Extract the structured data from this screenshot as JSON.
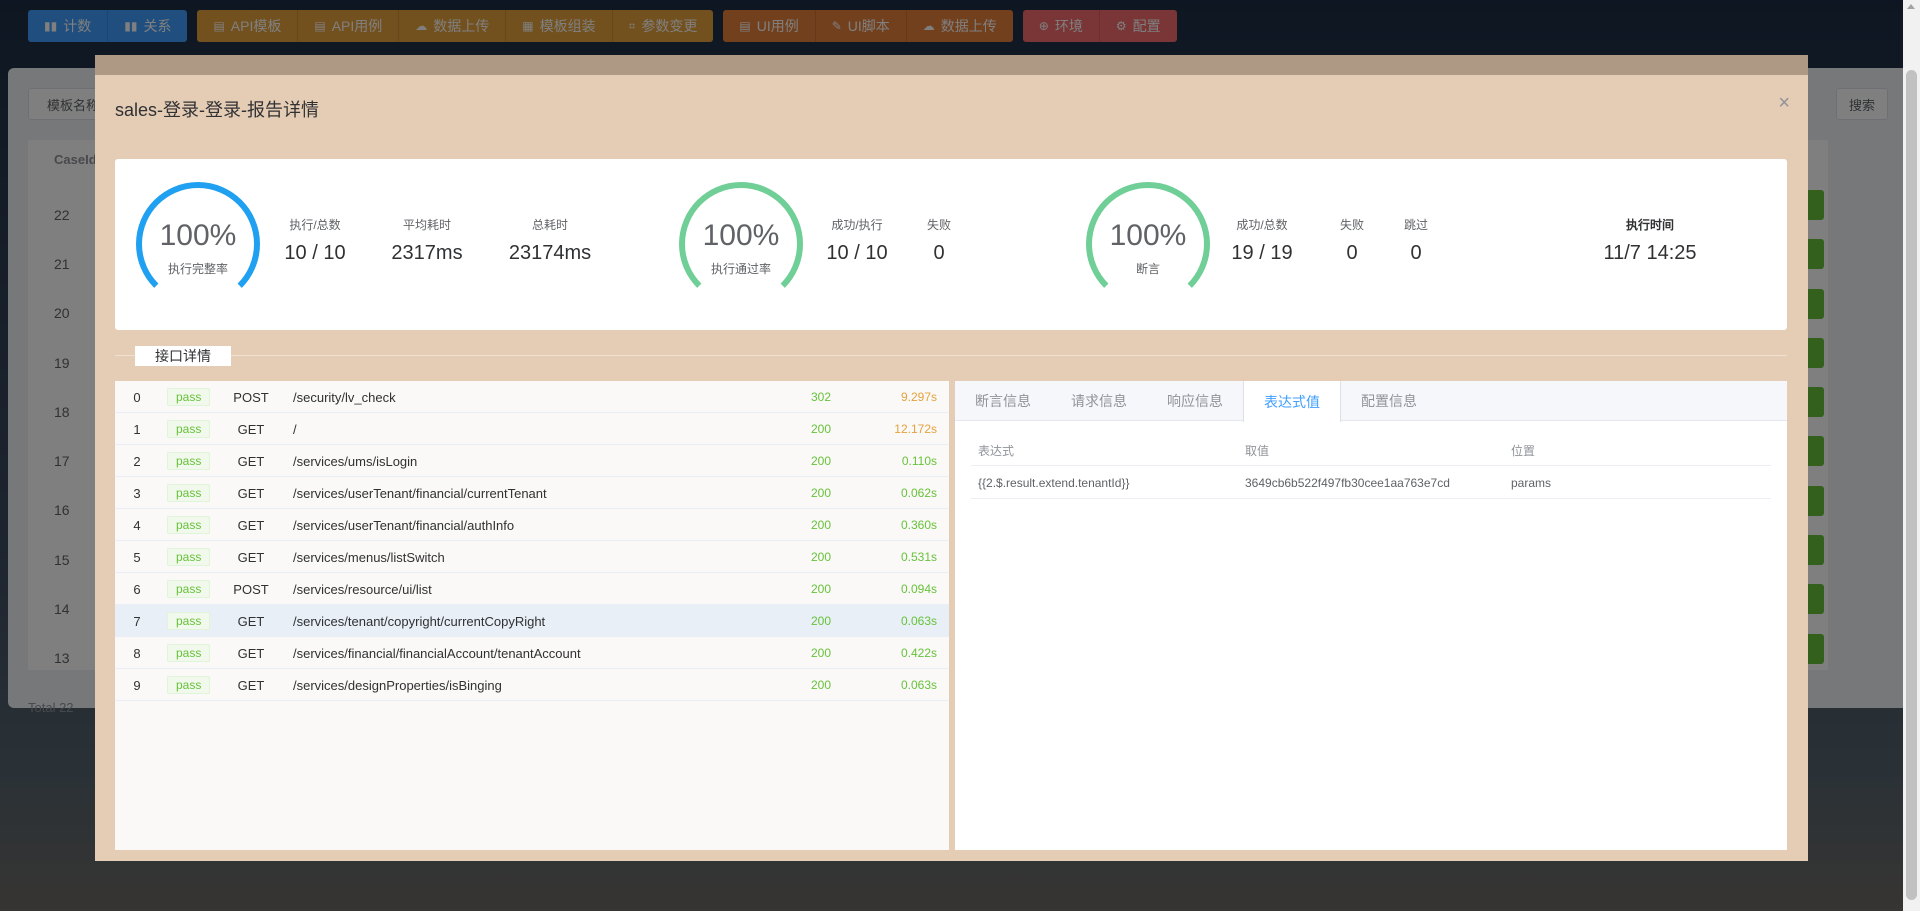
{
  "topnav": {
    "group1": [
      {
        "icon": "bar-chart-icon",
        "label": "计数"
      },
      {
        "icon": "bar-chart-icon",
        "label": "关系"
      }
    ],
    "group2": [
      {
        "icon": "document-icon",
        "label": "API模板"
      },
      {
        "icon": "document-icon",
        "label": "API用例"
      },
      {
        "icon": "cloud-upload-icon",
        "label": "数据上传"
      },
      {
        "icon": "grid-icon",
        "label": "模板组装"
      },
      {
        "icon": "crop-icon",
        "label": "参数变更"
      }
    ],
    "group3": [
      {
        "icon": "document-icon",
        "label": "UI用例"
      },
      {
        "icon": "edit-icon",
        "label": "UI脚本"
      },
      {
        "icon": "cloud-upload-icon",
        "label": "数据上传"
      }
    ],
    "group4": [
      {
        "icon": "circle-plus-icon",
        "label": "环境"
      },
      {
        "icon": "gear-icon",
        "label": "配置"
      }
    ]
  },
  "background": {
    "search_label": "模板名称",
    "search_button": "搜索",
    "table_header": "CaseId",
    "row_ids": [
      "22",
      "21",
      "20",
      "19",
      "18",
      "17",
      "16",
      "15",
      "14",
      "13"
    ],
    "total": "Total 22"
  },
  "dialog": {
    "title": "sales-登录-登录-报告详情",
    "close": "×"
  },
  "stats": {
    "gauge1": {
      "value": "100%",
      "label": "执行完整率",
      "fraction": 1.0,
      "color": "#1fa0f0"
    },
    "exec_total": {
      "label": "执行/总数",
      "value": "10 / 10"
    },
    "avg_time": {
      "label": "平均耗时",
      "value": "2317ms"
    },
    "total_time": {
      "label": "总耗时",
      "value": "23174ms"
    },
    "gauge2": {
      "value": "100%",
      "label": "执行通过率",
      "fraction": 1.0,
      "color": "#6fcf97"
    },
    "success_exec": {
      "label": "成功/执行",
      "value": "10 / 10"
    },
    "fail1": {
      "label": "失败",
      "value": "0"
    },
    "gauge3": {
      "value": "100%",
      "label": "断言",
      "fraction": 1.0,
      "color": "#6fcf97"
    },
    "success_total": {
      "label": "成功/总数",
      "value": "19 / 19"
    },
    "fail2": {
      "label": "失败",
      "value": "0"
    },
    "skip": {
      "label": "跳过",
      "value": "0"
    },
    "exec_time": {
      "label": "执行时间",
      "value": "11/7 14:25"
    }
  },
  "section_label": "接口详情",
  "api_rows": [
    {
      "idx": "0",
      "status": "pass",
      "method": "POST",
      "path": "/security/lv_check",
      "code": "302",
      "time": "9.297s",
      "slow": true
    },
    {
      "idx": "1",
      "status": "pass",
      "method": "GET",
      "path": "/",
      "code": "200",
      "time": "12.172s",
      "slow": true
    },
    {
      "idx": "2",
      "status": "pass",
      "method": "GET",
      "path": "/services/ums/isLogin",
      "code": "200",
      "time": "0.110s",
      "slow": false
    },
    {
      "idx": "3",
      "status": "pass",
      "method": "GET",
      "path": "/services/userTenant/financial/currentTenant",
      "code": "200",
      "time": "0.062s",
      "slow": false
    },
    {
      "idx": "4",
      "status": "pass",
      "method": "GET",
      "path": "/services/userTenant/financial/authInfo",
      "code": "200",
      "time": "0.360s",
      "slow": false
    },
    {
      "idx": "5",
      "status": "pass",
      "method": "GET",
      "path": "/services/menus/listSwitch",
      "code": "200",
      "time": "0.531s",
      "slow": false
    },
    {
      "idx": "6",
      "status": "pass",
      "method": "POST",
      "path": "/services/resource/ui/list",
      "code": "200",
      "time": "0.094s",
      "slow": false
    },
    {
      "idx": "7",
      "status": "pass",
      "method": "GET",
      "path": "/services/tenant/copyright/currentCopyRight",
      "code": "200",
      "time": "0.063s",
      "slow": false,
      "highlighted": true
    },
    {
      "idx": "8",
      "status": "pass",
      "method": "GET",
      "path": "/services/financial/financialAccount/tenantAccount",
      "code": "200",
      "time": "0.422s",
      "slow": false
    },
    {
      "idx": "9",
      "status": "pass",
      "method": "GET",
      "path": "/services/designProperties/isBinging",
      "code": "200",
      "time": "0.063s",
      "slow": false
    }
  ],
  "detail": {
    "tabs": [
      "断言信息",
      "请求信息",
      "响应信息",
      "表达式值",
      "配置信息"
    ],
    "active_tab": 3,
    "columns": [
      "表达式",
      "取值",
      "位置"
    ],
    "rows": [
      {
        "expr": "{{2.$.result.extend.tenantId}}",
        "value": "3649cb6b522f497fb30cee1aa763e7cd",
        "location": "params"
      }
    ]
  }
}
